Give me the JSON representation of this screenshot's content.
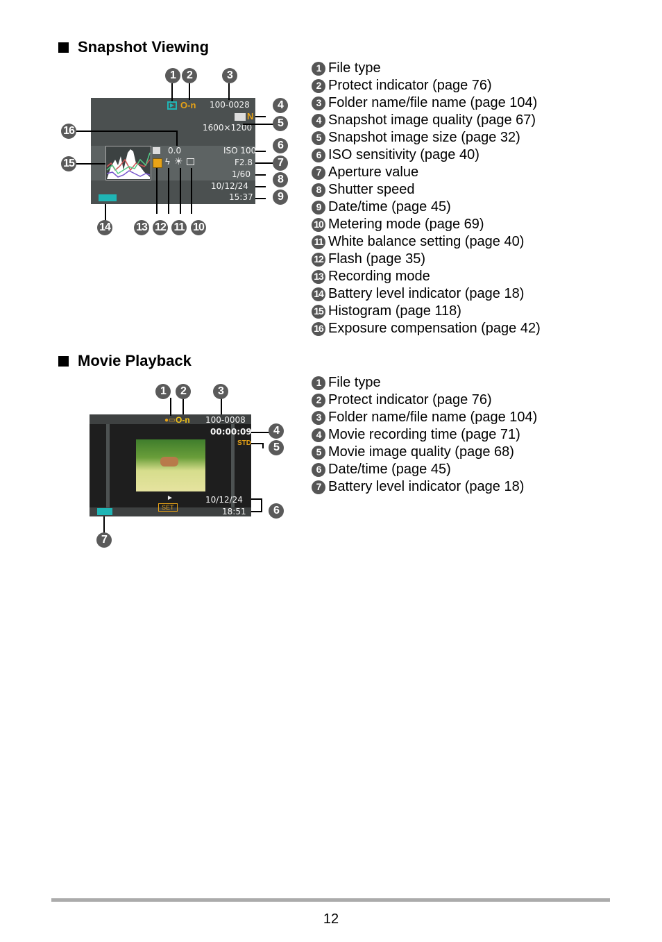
{
  "sections": {
    "snapshot": {
      "title": "Snapshot Viewing",
      "legend": [
        {
          "num": "1",
          "label": "File type"
        },
        {
          "num": "2",
          "label": "Protect indicator (page 76)"
        },
        {
          "num": "3",
          "label": "Folder name/file name (page 104)"
        },
        {
          "num": "4",
          "label": "Snapshot image quality (page 67)"
        },
        {
          "num": "5",
          "label": "Snapshot image size (page 32)"
        },
        {
          "num": "6",
          "label": "ISO sensitivity (page 40)"
        },
        {
          "num": "7",
          "label": "Aperture value"
        },
        {
          "num": "8",
          "label": "Shutter speed"
        },
        {
          "num": "9",
          "label": "Date/time (page 45)"
        },
        {
          "num": "10",
          "label": "Metering mode (page 69)"
        },
        {
          "num": "11",
          "label": "White balance setting (page 40)"
        },
        {
          "num": "12",
          "label": "Flash (page 35)"
        },
        {
          "num": "13",
          "label": "Recording mode"
        },
        {
          "num": "14",
          "label": "Battery level indicator (page 18)"
        },
        {
          "num": "15",
          "label": "Histogram (page 118)"
        },
        {
          "num": "16",
          "label": "Exposure compensation (page 42)"
        }
      ],
      "screen": {
        "file_name": "100-0028",
        "quality": "N",
        "image_size": "1600×1200",
        "exposure_comp": "0.0",
        "iso": "ISO 100",
        "aperture": "F2.8",
        "shutter": "1/60",
        "date": "10/12/24",
        "time": "15:37"
      }
    },
    "movie": {
      "title": "Movie Playback",
      "legend": [
        {
          "num": "1",
          "label": "File type"
        },
        {
          "num": "2",
          "label": "Protect indicator (page 76)"
        },
        {
          "num": "3",
          "label": "Folder name/file name (page 104)"
        },
        {
          "num": "4",
          "label": "Movie recording time (page 71)"
        },
        {
          "num": "5",
          "label": "Movie image quality (page 68)"
        },
        {
          "num": "6",
          "label": "Date/time (page 45)"
        },
        {
          "num": "7",
          "label": "Battery level indicator (page 18)"
        }
      ],
      "screen": {
        "file_name": "100-0008",
        "recording_time": "00:00:09",
        "quality": "STD",
        "play_symbol": "►",
        "set_label": "SET",
        "date": "10/12/24",
        "time": "18:51"
      }
    }
  },
  "colors": {
    "screen_bg": "#4a4f4f",
    "accent_orange": "#e8a317",
    "accent_teal": "#1fb5b5",
    "badge_gray": "#555555"
  },
  "footer": {
    "page_number": "12"
  }
}
